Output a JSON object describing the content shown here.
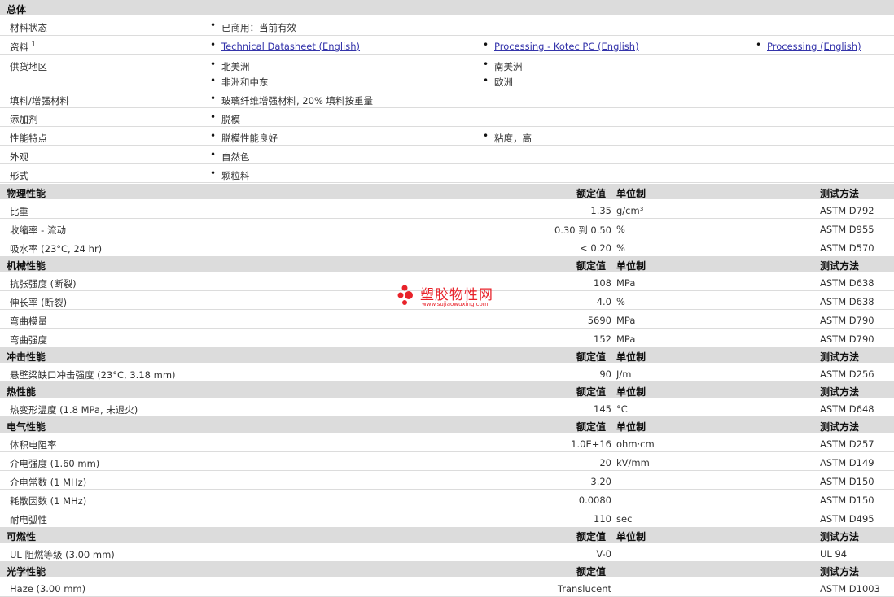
{
  "sections": {
    "general": "总体",
    "physical": "物理性能",
    "mechanical": "机械性能",
    "impact": "冲击性能",
    "thermal": "热性能",
    "electrical": "电气性能",
    "flammability": "可燃性",
    "optical": "光学性能"
  },
  "headers": {
    "nominal": "额定值",
    "unit": "单位制",
    "method": "测试方法"
  },
  "general": {
    "status_label": "材料状态",
    "status_value": "已商用：当前有效",
    "docs_label": "资料",
    "docs_sup": "1",
    "docs": [
      "Technical Datasheet (English)",
      "Processing - Kotec PC (English)",
      "Processing (English)"
    ],
    "regions_label": "供货地区",
    "regions": [
      "北美洲",
      "南美洲",
      "非洲和中东",
      "欧洲"
    ],
    "filler_label": "填料/增强材料",
    "filler_value": "玻璃纤维增强材料, 20% 填料按重量",
    "additive_label": "添加剂",
    "additive_value": "脱模",
    "features_label": "性能特点",
    "features": [
      "脱模性能良好",
      "粘度，高"
    ],
    "appearance_label": "外观",
    "appearance_value": "自然色",
    "form_label": "形式",
    "form_value": "颗粒料"
  },
  "physical_rows": [
    {
      "name": "比重",
      "value": "1.35",
      "unit": "g/cm³",
      "method": "ASTM D792"
    },
    {
      "name": "收缩率 - 流动",
      "value": "0.30 到 0.50",
      "unit": "%",
      "method": "ASTM D955"
    },
    {
      "name": "吸水率 (23°C, 24 hr)",
      "value": "< 0.20",
      "unit": "%",
      "method": "ASTM D570"
    }
  ],
  "mechanical_rows": [
    {
      "name": "抗张强度 (断裂)",
      "value": "108",
      "unit": "MPa",
      "method": "ASTM D638"
    },
    {
      "name": "伸长率 (断裂)",
      "value": "4.0",
      "unit": "%",
      "method": "ASTM D638"
    },
    {
      "name": "弯曲模量",
      "value": "5690",
      "unit": "MPa",
      "method": "ASTM D790"
    },
    {
      "name": "弯曲强度",
      "value": "152",
      "unit": "MPa",
      "method": "ASTM D790"
    }
  ],
  "impact_rows": [
    {
      "name": "悬壁梁缺口冲击强度 (23°C, 3.18 mm)",
      "value": "90",
      "unit": "J/m",
      "method": "ASTM D256"
    }
  ],
  "thermal_rows": [
    {
      "name": "热变形温度 (1.8 MPa, 未退火)",
      "value": "145",
      "unit": "°C",
      "method": "ASTM D648"
    }
  ],
  "electrical_rows": [
    {
      "name": "体积电阻率",
      "value": "1.0E+16",
      "unit": "ohm·cm",
      "method": "ASTM D257"
    },
    {
      "name": "介电强度 (1.60 mm)",
      "value": "20",
      "unit": "kV/mm",
      "method": "ASTM D149"
    },
    {
      "name": "介电常数 (1 MHz)",
      "value": "3.20",
      "unit": "",
      "method": "ASTM D150"
    },
    {
      "name": "耗散因数 (1 MHz)",
      "value": "0.0080",
      "unit": "",
      "method": "ASTM D150"
    },
    {
      "name": "耐电弧性",
      "value": "110",
      "unit": "sec",
      "method": "ASTM D495"
    }
  ],
  "flammability_rows": [
    {
      "name": "UL 阻燃等级 (3.00 mm)",
      "value": "V-0",
      "unit": "",
      "method": "UL 94"
    }
  ],
  "optical_rows": [
    {
      "name": "Haze (3.00 mm)",
      "value": "Translucent",
      "unit": "",
      "method": "ASTM D1003"
    }
  ],
  "watermark": {
    "name": "塑胶物性网",
    "url": "www.sujiaowuxing.com"
  },
  "colors": {
    "header_bg": "#dcdcdc",
    "link": "#3333aa",
    "watermark": "#e8222a"
  }
}
